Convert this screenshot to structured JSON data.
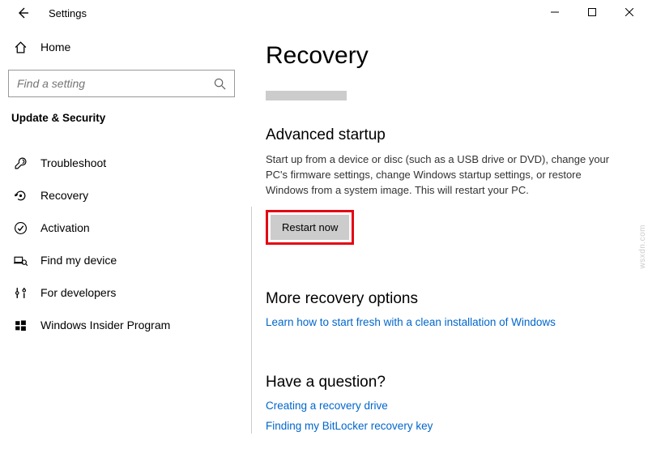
{
  "titlebar": {
    "title": "Settings"
  },
  "sidebar": {
    "home": "Home",
    "search_placeholder": "Find a setting",
    "category": "Update & Security",
    "items": [
      {
        "label": "Troubleshoot"
      },
      {
        "label": "Recovery"
      },
      {
        "label": "Activation"
      },
      {
        "label": "Find my device"
      },
      {
        "label": "For developers"
      },
      {
        "label": "Windows Insider Program"
      }
    ]
  },
  "main": {
    "title": "Recovery",
    "advanced": {
      "heading": "Advanced startup",
      "desc": "Start up from a device or disc (such as a USB drive or DVD), change your PC's firmware settings, change Windows startup settings, or restore Windows from a system image. This will restart your PC.",
      "button": "Restart now"
    },
    "more": {
      "heading": "More recovery options",
      "link": "Learn how to start fresh with a clean installation of Windows"
    },
    "question": {
      "heading": "Have a question?",
      "links": [
        "Creating a recovery drive",
        "Finding my BitLocker recovery key"
      ]
    }
  },
  "watermark": "wsxdn.com"
}
